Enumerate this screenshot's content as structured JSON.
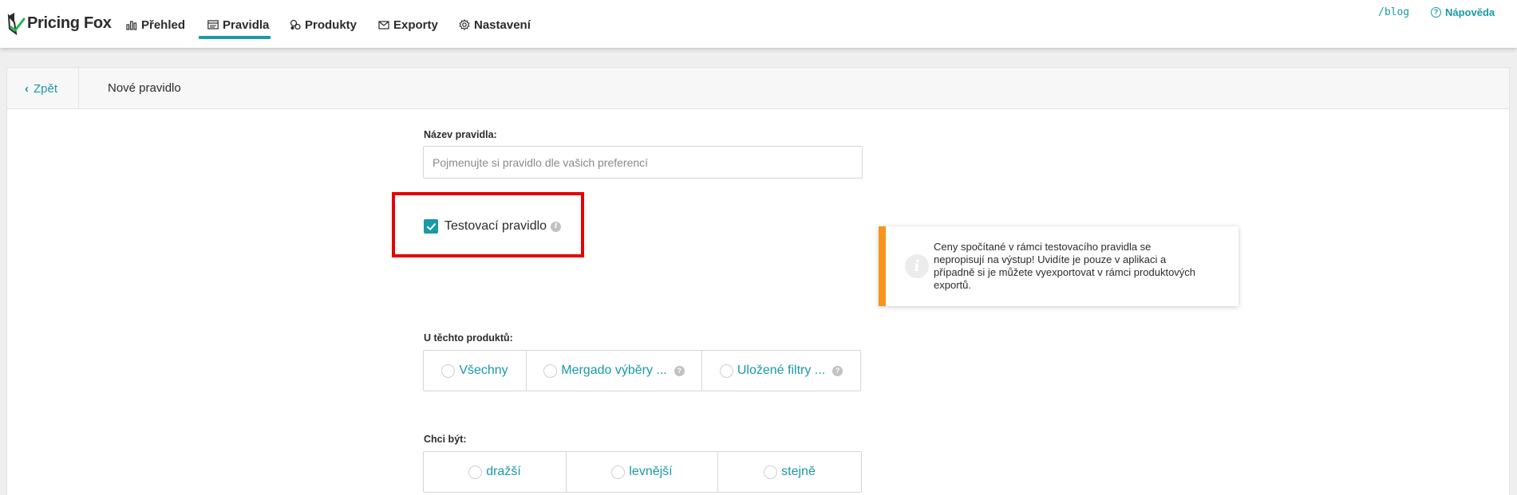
{
  "brand": {
    "name": "Pricing Fox"
  },
  "nav": {
    "items": [
      {
        "label": "Přehled",
        "icon": "bar-chart-icon"
      },
      {
        "label": "Pravidla",
        "icon": "rules-icon",
        "active": true
      },
      {
        "label": "Produkty",
        "icon": "products-icon"
      },
      {
        "label": "Exporty",
        "icon": "envelope-icon"
      },
      {
        "label": "Nastavení",
        "icon": "gear-icon"
      }
    ],
    "blog_label": "/blog",
    "help_label": "Nápověda"
  },
  "panel": {
    "back_label": "Zpět",
    "title": "Nové pravidlo"
  },
  "form": {
    "name_label": "Název pravidla:",
    "name_placeholder": "Pojmenujte si pravidlo dle vašich preferencí",
    "name_value": "",
    "test_rule_label": "Testovací pravidlo",
    "test_rule_checked": true,
    "notice_text": "Ceny spočítané v rámci testovacího pravidla se nepropisují na výstup! Uvidíte je pouze v aplikaci a případně si je můžete vyexportovat v rámci produktových exportů.",
    "products_label": "U těchto produktů:",
    "products_options": [
      "Všechny",
      "Mergado výběry ...",
      "Uložené filtry ..."
    ],
    "want_label": "Chci být:",
    "want_options": [
      "dražší",
      "levnější",
      "stejně"
    ]
  },
  "colors": {
    "accent": "#1a99a8",
    "notice_bar": "#f7941d",
    "highlight": "#e60000"
  }
}
